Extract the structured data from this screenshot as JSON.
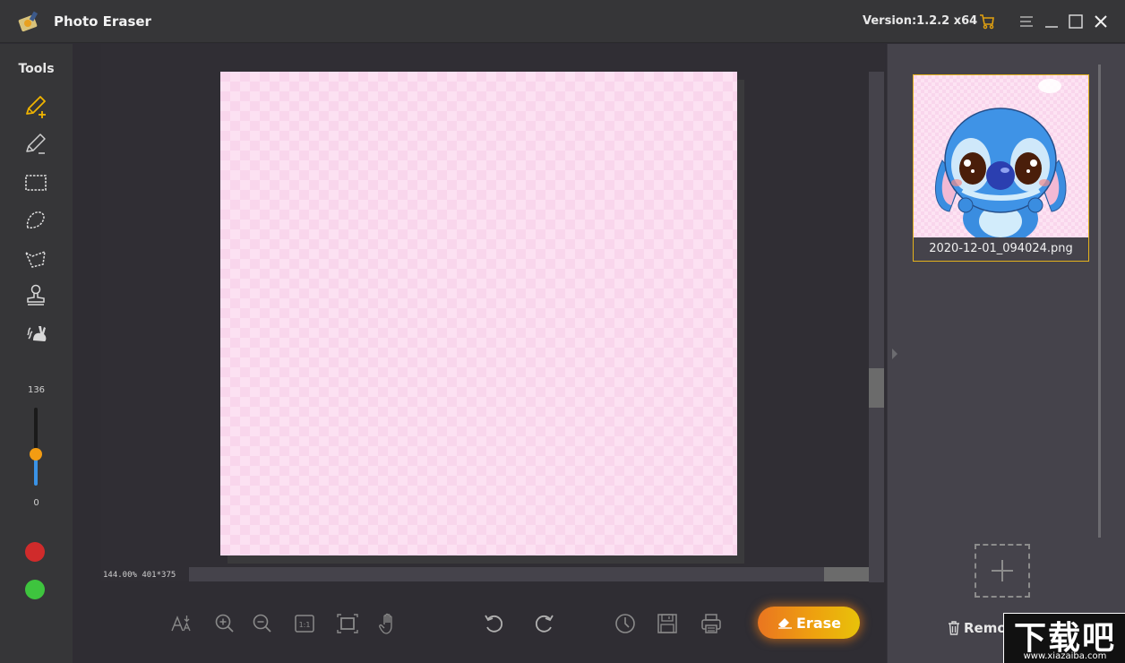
{
  "titlebar": {
    "app_title": "Photo Eraser",
    "version": "Version:1.2.2 x64",
    "icons": [
      "app-logo-icon",
      "cart-icon",
      "menu-icon",
      "minimize-icon",
      "maximize-icon",
      "close-icon"
    ]
  },
  "tools": {
    "label": "Tools",
    "items": [
      {
        "name": "brush-add",
        "icon": "pencil-plus-icon",
        "active": true
      },
      {
        "name": "brush-remove",
        "icon": "pencil-minus-icon",
        "active": false
      },
      {
        "name": "rectangle-select",
        "icon": "dashed-rectangle-icon",
        "active": false
      },
      {
        "name": "lasso-select",
        "icon": "lasso-icon",
        "active": false
      },
      {
        "name": "polygon-select",
        "icon": "polygon-lasso-icon",
        "active": false
      },
      {
        "name": "clone-stamp",
        "icon": "stamp-icon",
        "active": false
      },
      {
        "name": "quick-repair",
        "icon": "rabbit-icon",
        "active": false
      }
    ],
    "brush_size": {
      "max_label": "136",
      "min_label": "0",
      "value_fraction": 0.4
    },
    "colors": {
      "red": "#d02b2b",
      "green": "#3ec43e"
    }
  },
  "canvas": {
    "zoom_info": "144.00% 401*375"
  },
  "bottom_toolbar": {
    "icons": [
      "font-size-icon",
      "zoom-in-icon",
      "zoom-out-icon",
      "actual-size-icon",
      "fit-screen-icon",
      "hand-pan-icon",
      "undo-icon",
      "redo-icon",
      "history-icon",
      "save-icon",
      "print-icon"
    ],
    "erase_label": "Erase"
  },
  "right_panel": {
    "files": [
      {
        "name": "2020-12-01_094024.png",
        "selected": true
      }
    ],
    "remove_label": "Remove"
  },
  "watermark": {
    "big": "下载吧",
    "small": "www.xiazaiba.com"
  },
  "colors": {
    "accent": "#e3b21d",
    "active_tool": "#f0b400",
    "icon_gray": "#8a8a8a",
    "slider_blue": "#3a93e6",
    "slider_knob": "#f39c12"
  }
}
